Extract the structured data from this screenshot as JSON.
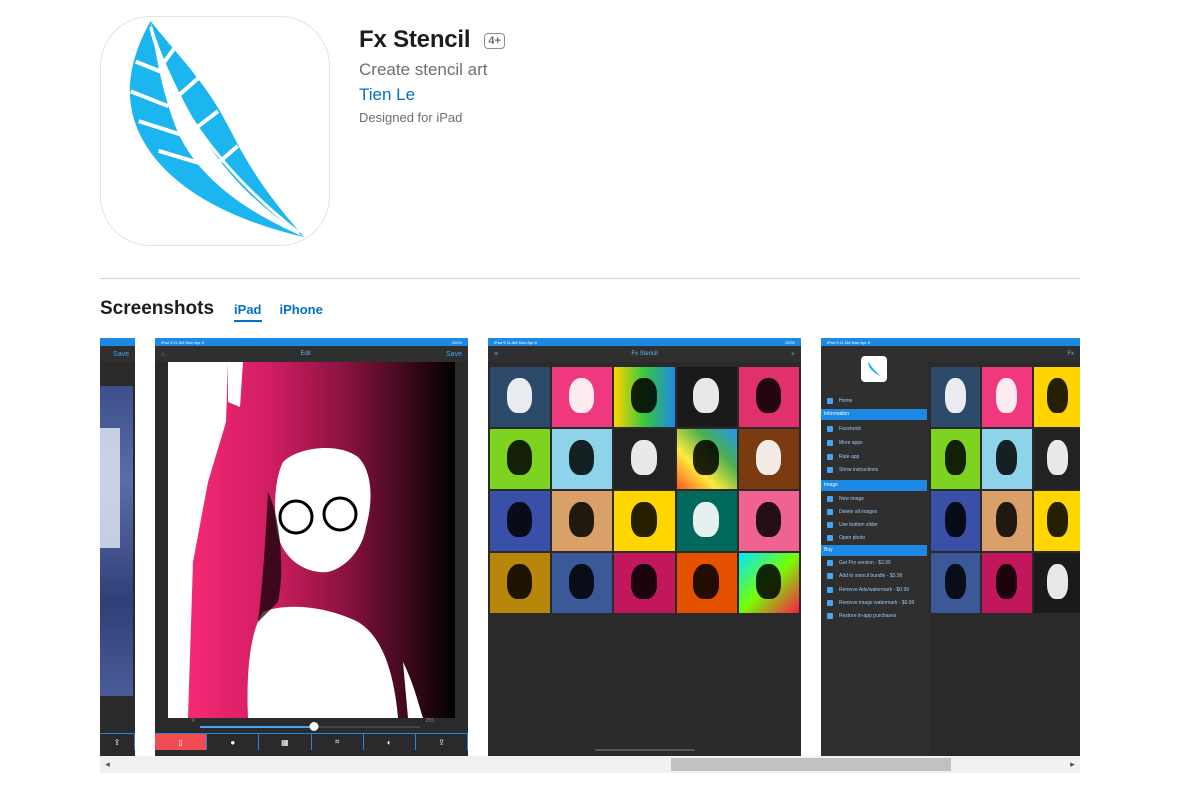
{
  "app": {
    "title": "Fx Stencil",
    "age_rating": "4+",
    "subtitle": "Create stencil art",
    "developer": "Tien Le",
    "designed_for": "Designed for iPad",
    "icon": "feather-icon",
    "accent_color": "#1bb5f0"
  },
  "screenshots": {
    "title": "Screenshots",
    "tabs": [
      {
        "label": "iPad",
        "active": true
      },
      {
        "label": "iPhone",
        "active": false
      }
    ],
    "shot1": {
      "bar_button": "Save"
    },
    "shot2": {
      "status_left": "iPad 9:11 AM Mon Apr 8",
      "status_right": "100%",
      "bar_title": "Edit",
      "bar_button": "Save",
      "slider_min": "0",
      "slider_max": "255",
      "slider_value": 0.52
    },
    "shot3": {
      "status_left": "iPad 9:11 AM Mon Apr 8",
      "status_right": "100%",
      "bar_title": "Fx Stencil",
      "bar_button": "+"
    },
    "shot4": {
      "status_left": "iPad 9:11 AM Mon Apr 8",
      "bar_title": "Fx",
      "menu": {
        "home": "Home",
        "information_header": "Information",
        "facebook": "Facebook",
        "more_apps": "More apps",
        "rate_app": "Rate app",
        "show_instructions": "Show instructions",
        "image_header": "Image",
        "new_image": "New image",
        "delete_all_images": "Delete all images",
        "use_bottom_slider": "Use bottom slider",
        "open_photo": "Open photo",
        "buy_header": "Buy",
        "buy_1": "Get Pro version - $3.99",
        "buy_2": "Add to stencil bundle - $3.99",
        "buy_3": "Remove Ads/watermark - $0.99",
        "buy_4": "Remove image watermark - $0.99",
        "restore": "Restore in-app purchases"
      }
    }
  },
  "colors": {
    "link": "#0070c9",
    "ios_blue": "#1e88e5",
    "magenta": "#ff2c7a"
  }
}
